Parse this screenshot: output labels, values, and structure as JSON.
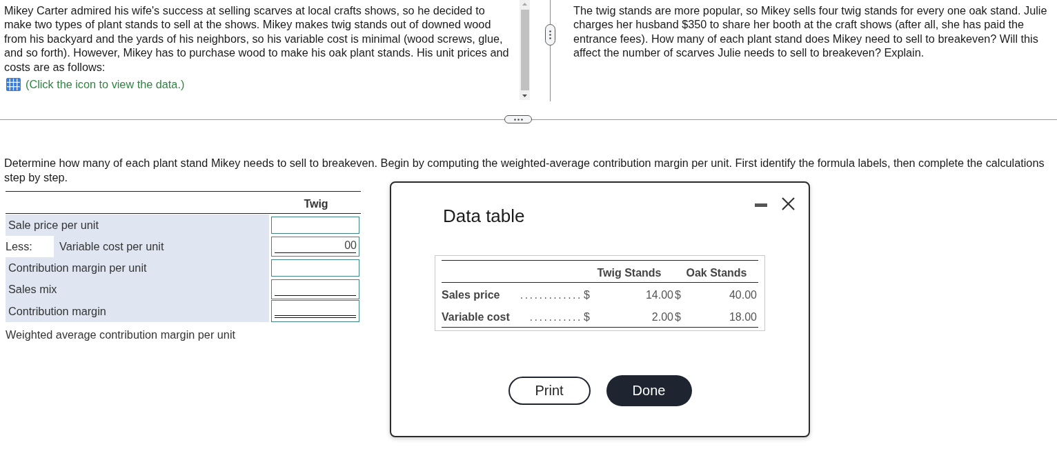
{
  "problem": {
    "text": "Mikey Carter admired his wife's success at selling scarves at local crafts shows, so he decided to make two types of plant stands to sell at the shows. Mikey makes twig stands out of downed wood from his backyard and the yards of his neighbors, so his variable cost is minimal (wood screws, glue, and so forth). However, Mikey has to purchase wood to make his oak plant stands. His unit prices and costs are as follows:",
    "data_link": "(Click the icon to view the data.)"
  },
  "requirement": {
    "text": "The twig stands are more popular, so Mikey sells four twig stands for every one oak stand. Julie charges her husband $350 to share her booth at the craft shows (after all, she has paid the entrance fees). How many of each plant stand does Mikey need to sell to breakeven? Will this affect the number of scarves Julie needs to sell to breakeven? Explain."
  },
  "instructions": "Determine how many of each plant stand Mikey needs to sell to breakeven. Begin by computing the weighted-average contribution margin per unit. First identify the formula labels, then complete the calculations step by step.",
  "worksheet": {
    "columns": [
      "Twig"
    ],
    "rows": [
      {
        "kind": "plain",
        "label": "Sale price per unit"
      },
      {
        "kind": "underlined",
        "prefix": "Less:",
        "label": "Variable cost per unit",
        "value": "00"
      },
      {
        "kind": "plain",
        "label": "Contribution margin per unit"
      },
      {
        "kind": "underlined",
        "label": "Sales mix"
      },
      {
        "kind": "double_underlined",
        "label": "Contribution margin"
      },
      {
        "kind": "total",
        "label": "Weighted average contribution margin per unit"
      }
    ]
  },
  "data_dialog": {
    "title": "Data table",
    "columns": [
      "Twig Stands",
      "Oak Stands"
    ],
    "rows": [
      {
        "label": "Sales price",
        "leader": ".............",
        "cells": [
          {
            "currency": "$",
            "value": "14.00"
          },
          {
            "currency": "$",
            "value": "40.00"
          }
        ]
      },
      {
        "label": "Variable cost",
        "leader": "...........",
        "cells": [
          {
            "currency": "$",
            "value": "2.00"
          },
          {
            "currency": "$",
            "value": "18.00"
          }
        ]
      }
    ],
    "buttons": [
      {
        "kind": "print",
        "label": "Print"
      },
      {
        "kind": "done",
        "label": "Done"
      }
    ]
  }
}
